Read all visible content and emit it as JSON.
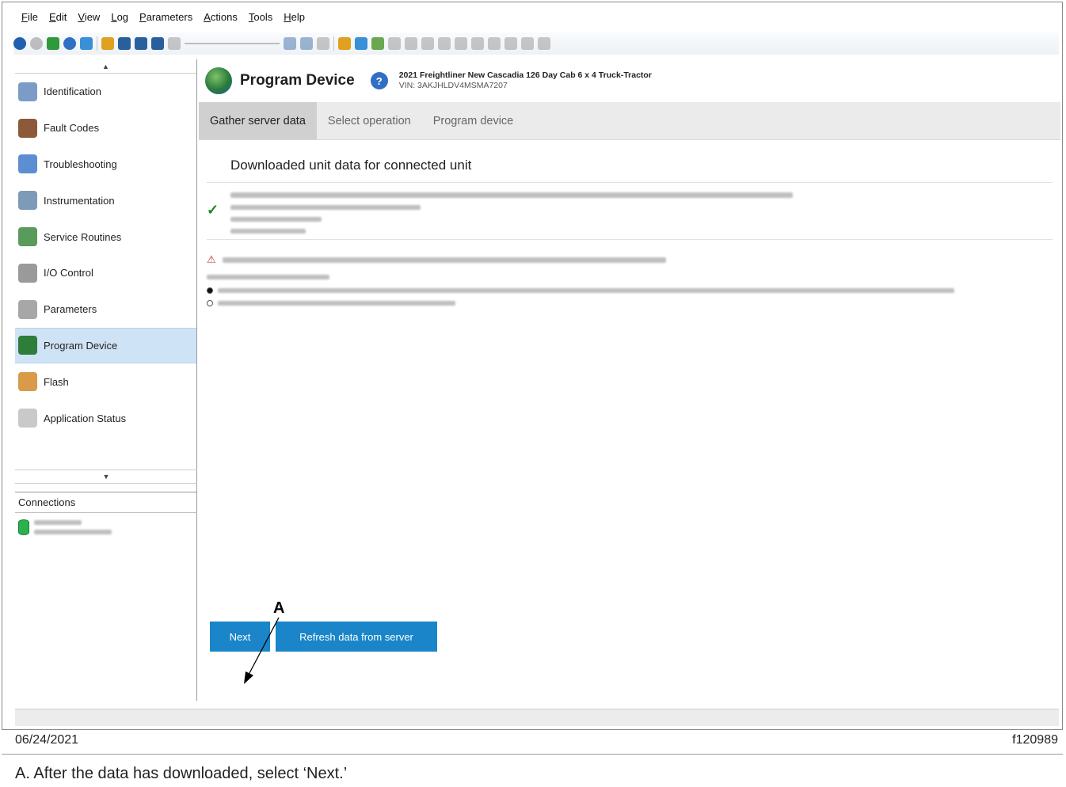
{
  "menu": [
    "File",
    "Edit",
    "View",
    "Log",
    "Parameters",
    "Actions",
    "Tools",
    "Help"
  ],
  "sidebar": {
    "items": [
      {
        "label": "Identification",
        "icon": "id-card-icon",
        "color": "#7a9cc6"
      },
      {
        "label": "Fault Codes",
        "icon": "fault-bottle-icon",
        "color": "#8c5a3a"
      },
      {
        "label": "Troubleshooting",
        "icon": "stethoscope-icon",
        "color": "#5b8fd1"
      },
      {
        "label": "Instrumentation",
        "icon": "gauge-chart-icon",
        "color": "#7d9ab8"
      },
      {
        "label": "Service Routines",
        "icon": "gears-icon",
        "color": "#5a9a5a"
      },
      {
        "label": "I/O Control",
        "icon": "io-gear-icon",
        "color": "#9a9a9a"
      },
      {
        "label": "Parameters",
        "icon": "pencil-icon",
        "color": "#a7a7a7"
      },
      {
        "label": "Program Device",
        "icon": "globe-program-icon",
        "color": "#2e7d3a"
      },
      {
        "label": "Flash",
        "icon": "flash-hand-icon",
        "color": "#d99a4a"
      },
      {
        "label": "Application Status",
        "icon": "status-icon",
        "color": "#c9c9c9"
      }
    ],
    "active_index": 7,
    "connections_label": "Connections"
  },
  "header": {
    "title": "Program Device",
    "vehicle": "2021 Freightliner New Cascadia 126 Day Cab 6 x 4 Truck-Tractor",
    "vin": "VIN: 3AKJHLDV4MSMA7207"
  },
  "tabs": [
    "Gather server data",
    "Select operation",
    "Program device"
  ],
  "active_tab": 0,
  "content": {
    "downloaded_title": "Downloaded unit data for connected unit"
  },
  "buttons": {
    "next": "Next",
    "refresh": "Refresh data from server"
  },
  "annotation": {
    "letter": "A"
  },
  "footer": {
    "date": "06/24/2021",
    "code": "f120989",
    "caption": "A. After the data has downloaded, select ‘Next.’"
  },
  "colors": {
    "accent_button": "#1a85c8",
    "active_nav": "#cfe3f6",
    "check": "#1a8a1a",
    "warning": "#c0392b"
  }
}
